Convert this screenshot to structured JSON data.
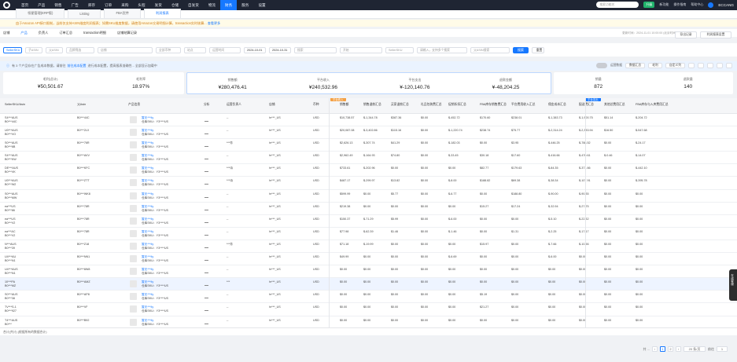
{
  "nav": {
    "items": [
      "首页",
      "产品",
      "销售",
      "广告",
      "库存",
      "订单",
      "采购",
      "头程",
      "发货",
      "仓储",
      "自发货",
      "物流",
      "财务",
      "服务",
      "设置"
    ],
    "active_index": 12,
    "search_placeholder": "搜索功能名",
    "upgrade": "升级",
    "links": [
      "新功能",
      "操作指南",
      "帮助中心"
    ],
    "badges": {
      "bell": "99",
      "msg": "2"
    },
    "user": "ECCANG"
  },
  "tabs": [
    "领星管理(ERP版)",
    "Listing",
    "FBA货件",
    "利润报表"
  ],
  "notice": {
    "text": "由于Amazon API接口限制，当前仅支持ASIN维度利润报表；如需SKU维度数据，请使用Amazon交易明细计算，transaction实时核算...",
    "link": "查看更多"
  },
  "subtabs": [
    "店铺",
    "产品",
    "负责人",
    "订单汇总",
    "transaction明细",
    "店铺结算记录"
  ],
  "subtabs_active": 1,
  "update_time": "更新时间：2024-11-01 10:00:00 (北京时间)",
  "buttons": {
    "export": "导出记录",
    "settings": "利润报表设置"
  },
  "filters": {
    "f1": "SellerSKU",
    "f2": "子ASIN",
    "f3": "父ASIN",
    "f4": "品牌筛选",
    "f5": "店铺",
    "f6": "全部币种",
    "f7": "站点",
    "f8": "运营时间",
    "date_from": "2024-10-01",
    "date_to": "2024-10-31",
    "f9": "搜索",
    "f10": "开始",
    "f11": "SellerSKU",
    "f12": "请输入，支持多个搜索",
    "f13": "父ASIN搜索",
    "search": "搜索",
    "reset": "重置"
  },
  "info": {
    "pre": "有 3 个产品存在广告成本数据，请前往",
    "link": "前往成本配置",
    "post": "进行成本配置，提高报表准确性... 全部显示加载中",
    "toggle": "运营数据",
    "btns": [
      "数据汇总",
      "毛利"
    ],
    "btn2": "自定义列"
  },
  "kpis": [
    {
      "label": "毛利(总计)",
      "value": "¥50,501.67"
    },
    {
      "label": "毛利率",
      "value": "18.97%"
    },
    {
      "label": "销售额",
      "value": "¥280,476.41"
    },
    {
      "label": "平台收入",
      "value": "¥240,532.96"
    },
    {
      "label": "平台支出",
      "value": "¥-120,140.76"
    },
    {
      "label": "退款金额",
      "value": "¥-48,204.25"
    },
    {
      "label": "销量",
      "value": "872"
    },
    {
      "label": "退款量",
      "value": "140"
    }
  ],
  "grid": {
    "headers": [
      "SellerSKU/Asin",
      "父Asin",
      "产品信息",
      "分析",
      "运营负责人",
      "店铺",
      "币种",
      "销售额",
      "销售退款汇总",
      "买家退款汇总",
      "礼品包装费汇总",
      "促销折扣汇总",
      "FBA库存销售费汇总",
      "平台费用收入汇总",
      "佣金成本汇总",
      "配送费汇总",
      "其他总费用汇总",
      "FBA库存与入库费用汇总"
    ],
    "badges": [
      "平台收入",
      "平台支出"
    ],
    "rows": [
      {
        "sku": "S4***AUS",
        "asin": "B0***44C",
        "parent": "B0***44C",
        "owner": "--",
        "shop": "hr***_US",
        "cur": "USD",
        "v": [
          "$10,738.57",
          "$-1,344.78",
          "$387.36",
          "$0.00",
          "$-452.72",
          "$170.60",
          "$238.01",
          "$-1,383.73",
          "$-1,900.75",
          "$51.14",
          "$-204.72"
        ],
        "star": false
      },
      {
        "sku": "U0***AUS",
        "asin": "B0***VO",
        "parent": "B0***2LX",
        "owner": "--",
        "shop": "hr***_US",
        "cur": "USD",
        "v": [
          "$20,087.08",
          "$-3,402.86",
          "$115.16",
          "$0.00",
          "$-1,220.74",
          "$238.74",
          "$75.77",
          "$-2,314.24",
          "$-2,383.94",
          "$16.50",
          "$-547.68"
        ],
        "star": true
      },
      {
        "sku": "S0***AUS",
        "asin": "B0***6B",
        "parent": "B0***76R",
        "owner": "***芳",
        "shop": "hr***_US",
        "cur": "USD",
        "v": [
          "$2,626.13",
          "$-307.74",
          "$41.29",
          "$0.00",
          "$-182.03",
          "$0.00",
          "$3.95",
          "$-446.25",
          "$-788.52",
          "$0.00",
          "$-24.17"
        ],
        "star": true
      },
      {
        "sku": "S4***AUS",
        "asin": "B0***KW",
        "parent": "B0***AVV",
        "owner": "--",
        "shop": "hr***_US",
        "cur": "USD",
        "v": [
          "$2,962.49",
          "$-164.93",
          "$74.80",
          "$0.00",
          "$-33.45",
          "$30.18",
          "$17.60",
          "$-416.66",
          "$-470.61",
          "$-0.46",
          "$-14.07"
        ],
        "star": false
      },
      {
        "sku": "DE***AUS",
        "asin": "B0***VK",
        "parent": "B0***KFC",
        "owner": "***诗",
        "shop": "hr***_US",
        "cur": "USD",
        "v": [
          "$733.61",
          "$-202.96",
          "$0.00",
          "$0.00",
          "$0.00",
          "$82.77",
          "$179.63",
          "$-84.35",
          "$-371.66",
          "$0.00",
          "$-442.10"
        ],
        "star": false
      },
      {
        "sku": "U0***AUS",
        "asin": "B0***W2",
        "parent": "B0***ZTT",
        "owner": "***诗",
        "shop": "hr***_US",
        "cur": "USD",
        "v": [
          "$487.17",
          "$-299.97",
          "$13.82",
          "$0.00",
          "$-8.00",
          "$188.82",
          "$69.38",
          "$-38.34",
          "$-107.91",
          "$0.00",
          "$-395.78"
        ],
        "star": true
      },
      {
        "sku": "S0***AUS",
        "asin": "B0***MW",
        "parent": "B0***WK8",
        "owner": "--",
        "shop": "hr***_US",
        "cur": "USD",
        "v": [
          "$599.99",
          "$0.00",
          "$5.77",
          "$0.00",
          "$-6.77",
          "$0.00",
          "$188.80",
          "$-90.00",
          "$-90.35",
          "$0.00",
          "$0.00"
        ],
        "star": false
      },
      {
        "sku": "ea***US",
        "asin": "B0***86",
        "parent": "B0***78R",
        "owner": "--",
        "shop": "hr***_US",
        "cur": "USD",
        "v": [
          "$219.38",
          "$0.00",
          "$0.00",
          "$0.00",
          "$0.00",
          "$15.27",
          "$17.24",
          "$-32.94",
          "$-27.75",
          "$0.00",
          "$0.00"
        ],
        "star": true
      },
      {
        "sku": "ea***US",
        "asin": "B0***V2",
        "parent": "B0***78R",
        "owner": "--",
        "shop": "hr***_US",
        "cur": "USD",
        "v": [
          "$150.37",
          "$-71.29",
          "$5.99",
          "$0.00",
          "$-6.00",
          "$0.00",
          "$0.00",
          "$-5.10",
          "$-22.32",
          "$0.00",
          "$0.00"
        ],
        "star": true
      },
      {
        "sku": "ea***AC",
        "asin": "B0***V2",
        "parent": "B0***78R",
        "owner": "--",
        "shop": "hr***_US",
        "cur": "USD",
        "v": [
          "$77.98",
          "$-62.39",
          "$1.46",
          "$0.00",
          "$-1.46",
          "$0.00",
          "$1.31",
          "$-2.25",
          "$-17.17",
          "$0.00",
          "$0.00"
        ],
        "star": false
      },
      {
        "sku": "N***AUS",
        "asin": "B0***39",
        "parent": "B0***Z18",
        "owner": "***芳",
        "shop": "hr***_US",
        "cur": "USD",
        "v": [
          "$71.18",
          "$-19.99",
          "$0.00",
          "$0.00",
          "$0.00",
          "$15.97",
          "$0.00",
          "$-7.66",
          "$-10.56",
          "$0.00",
          "$0.00"
        ],
        "star": false
      },
      {
        "sku": "U4***AU",
        "asin": "B0***N1",
        "parent": "B0***NN1",
        "owner": "--",
        "shop": "hr***_US",
        "cur": "USD",
        "v": [
          "$49.99",
          "$0.00",
          "$0.00",
          "$0.00",
          "$-6.69",
          "$0.00",
          "$0.00",
          "$-6.00",
          "$0.00",
          "$0.00",
          "$0.00"
        ],
        "star": false
      },
      {
        "sku": "U4***AUS",
        "asin": "B0***N1",
        "parent": "B0***8W8",
        "owner": "--",
        "shop": "hr***_US",
        "cur": "USD",
        "v": [
          "$0.00",
          "$0.00",
          "$0.00",
          "$0.00",
          "$0.00",
          "$0.00",
          "$0.00",
          "$0.00",
          "$0.00",
          "$0.00",
          "$0.00"
        ],
        "star": true
      },
      {
        "sku": "10***PA",
        "asin": "B0***MZ",
        "parent": "B0***AMZ",
        "owner": "***",
        "shop": "hr***_US",
        "cur": "USD",
        "v": [
          "$0.00",
          "$0.00",
          "$0.00",
          "$0.00",
          "$0.00",
          "$0.00",
          "$0.00",
          "$0.00",
          "$0.00",
          "$0.00",
          "$0.00"
        ],
        "star": false,
        "hl": true
      },
      {
        "sku": "S0***AUS",
        "asin": "B0***38",
        "parent": "B0***AP8",
        "owner": "--",
        "shop": "hr***_US",
        "cur": "USD",
        "v": [
          "$0.00",
          "$0.00",
          "$0.00",
          "$0.00",
          "$0.00",
          "$5.19",
          "$0.00",
          "$0.00",
          "$0.00",
          "$0.00",
          "$0.00"
        ],
        "star": false
      },
      {
        "sku": "TV***S-1",
        "asin": "B0***927",
        "parent": "B0***VF",
        "owner": "--",
        "shop": "hr***_US",
        "cur": "USD",
        "v": [
          "$0.00",
          "$0.00",
          "$0.00",
          "$0.00",
          "$0.00",
          "$21.27",
          "$0.00",
          "$0.00",
          "$0.00",
          "$0.00",
          "$0.00"
        ],
        "star": false
      },
      {
        "sku": "T4***AUS",
        "asin": "B0***",
        "parent": "B0***B92",
        "owner": "--",
        "shop": "hr***_US",
        "cur": "USD",
        "v": [
          "$0.00",
          "$0.00",
          "$0.00",
          "$0.00",
          "$0.00",
          "$0.00",
          "$0.00",
          "$0.00",
          "$0.00",
          "$0.00",
          "$0.00"
        ],
        "star": false
      }
    ],
    "prod_line1": "暂无***ily",
    "prod_line2": "仓库SKU：Y3****US"
  },
  "footer": "合计(共计) (根据所有的数据合计)",
  "pager": {
    "total": "共 ...",
    "pages": [
      "1",
      "2"
    ],
    "per_page": "20 条/页",
    "goto_label": "前往",
    "goto_val": "1"
  },
  "side_widget": "在线客服"
}
